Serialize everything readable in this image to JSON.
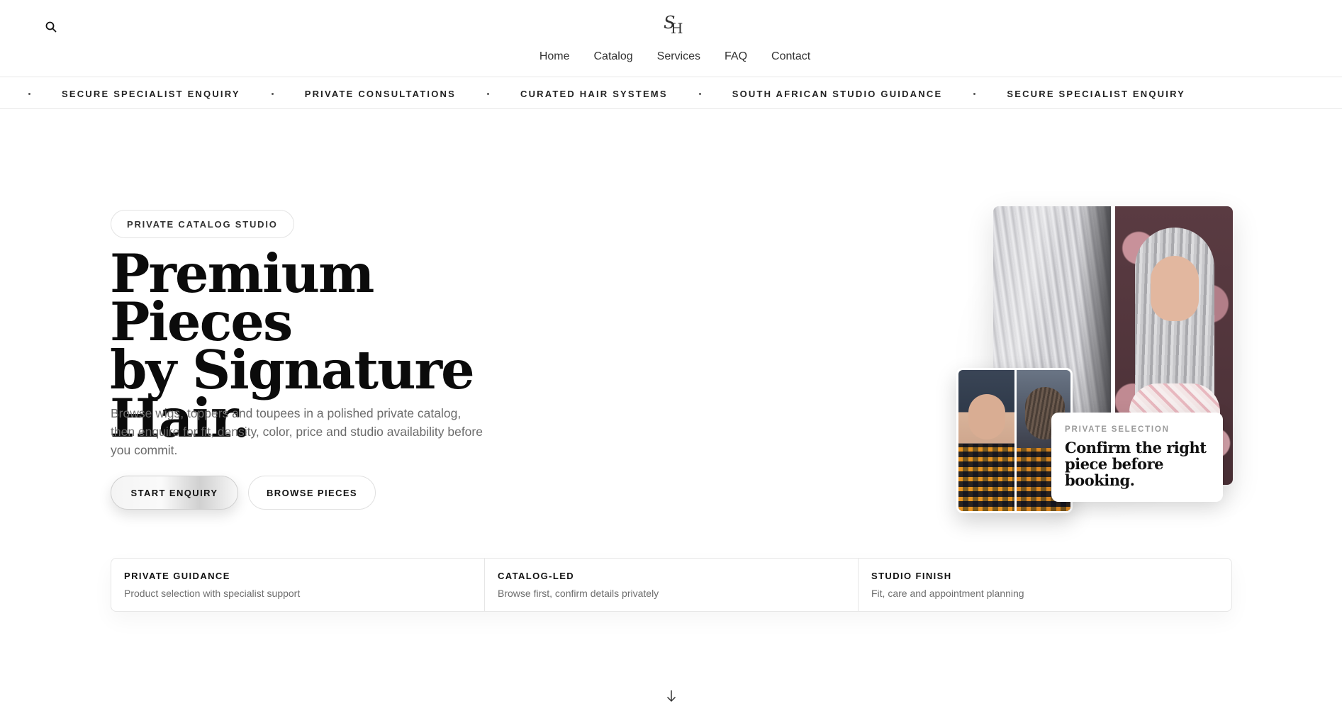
{
  "header": {
    "logo_text_1": "S",
    "logo_text_2": "H",
    "nav": [
      "Home",
      "Catalog",
      "Services",
      "FAQ",
      "Contact"
    ]
  },
  "marquee": {
    "items": [
      "SECURE SPECIALIST ENQUIRY",
      "PRIVATE CONSULTATIONS",
      "CURATED HAIR SYSTEMS",
      "SOUTH AFRICAN STUDIO GUIDANCE",
      "SECURE SPECIALIST ENQUIRY"
    ]
  },
  "hero": {
    "eyebrow": "PRIVATE CATALOG STUDIO",
    "title_line1": "Premium Pieces",
    "title_line2": "by Signature",
    "title_line3": "Hair.",
    "description": "Browse wigs, toppers and toupees in a polished private catalog, then enquire for fit, density, color, price and studio availability before you commit.",
    "primary_button": "START ENQUIRY",
    "secondary_button": "BROWSE PIECES",
    "overlay_eyebrow": "PRIVATE SELECTION",
    "overlay_title": "Confirm the right piece before booking."
  },
  "features": [
    {
      "title": "PRIVATE GUIDANCE",
      "text": "Product selection with specialist support"
    },
    {
      "title": "CATALOG-LED",
      "text": "Browse first, confirm details privately"
    },
    {
      "title": "STUDIO FINISH",
      "text": "Fit, care and appointment planning"
    }
  ],
  "icons": {
    "search": "search-icon",
    "scroll": "arrow-down-icon"
  },
  "colors": {
    "text": "#111111",
    "muted": "#6b6b6b",
    "border": "#e6e6e6",
    "background": "#ffffff"
  }
}
